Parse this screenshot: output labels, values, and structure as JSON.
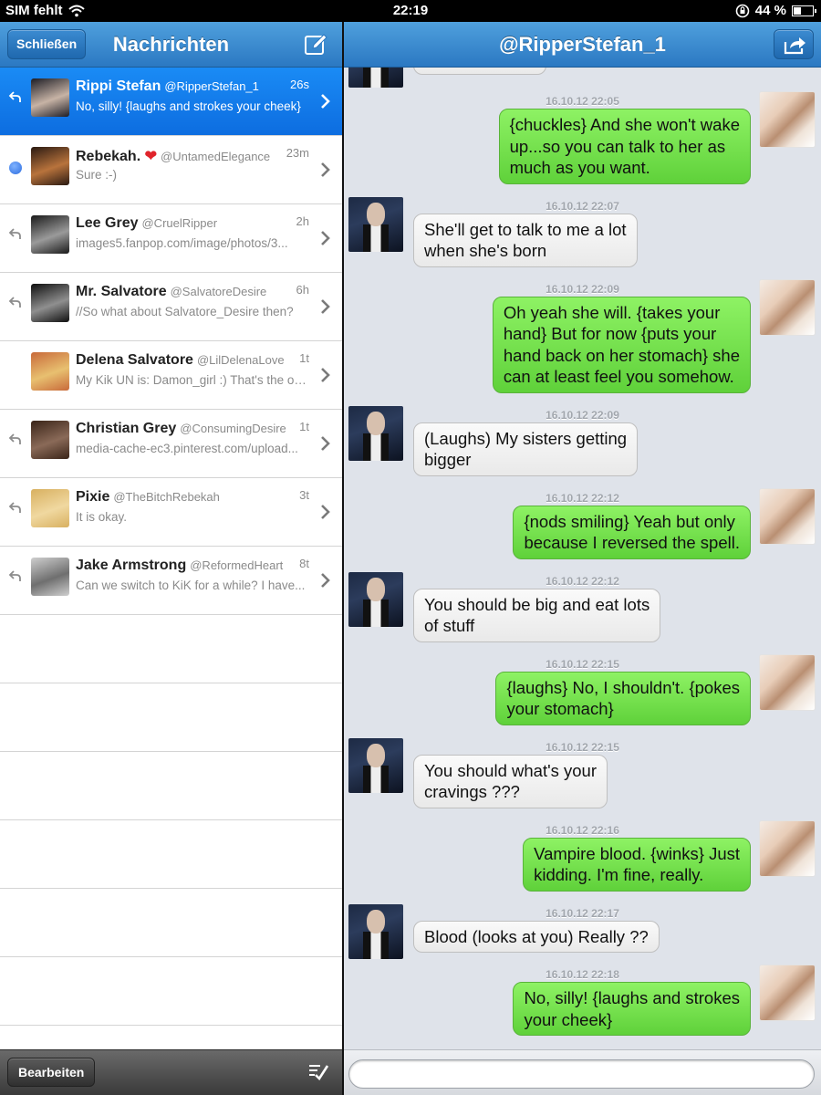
{
  "status": {
    "carrier": "SIM fehlt",
    "time": "22:19",
    "battery": "44 %",
    "battery_level": 0.44
  },
  "left": {
    "close_label": "Schließen",
    "title": "Nachrichten",
    "edit_label": "Bearbeiten",
    "conversations": [
      {
        "name": "Rippi Stefan",
        "handle": "@RipperStefan_1",
        "time": "26s",
        "preview": "No, silly! {laughs and strokes your cheek}",
        "selected": true,
        "unread": false,
        "replied": true,
        "heart": false,
        "avatar_colors": [
          "#1c1c24",
          "#c7b3a5"
        ]
      },
      {
        "name": "Rebekah.",
        "handle": "@UntamedElegance",
        "time": "23m",
        "preview": "Sure :-)",
        "selected": false,
        "unread": true,
        "replied": false,
        "heart": true,
        "avatar_colors": [
          "#2a1a12",
          "#b8733c"
        ]
      },
      {
        "name": "Lee Grey",
        "handle": "@CruelRipper",
        "time": "2h",
        "preview": "images5.fanpop.com/image/photos/3...",
        "selected": false,
        "unread": false,
        "replied": true,
        "heart": false,
        "avatar_colors": [
          "#1a1a1a",
          "#9a9a9a"
        ]
      },
      {
        "name": "Mr. Salvatore",
        "handle": "@SalvatoreDesire",
        "time": "6h",
        "preview": "//So what about Salvatore_Desire then?",
        "selected": false,
        "unread": false,
        "replied": true,
        "heart": false,
        "avatar_colors": [
          "#0f0f0f",
          "#8f8f8f"
        ]
      },
      {
        "name": "Delena Salvatore",
        "handle": "@LilDelenaLove",
        "time": "1t",
        "preview": "My Kik UN is: Damon_girl :) That's the one",
        "selected": false,
        "unread": false,
        "replied": false,
        "heart": false,
        "avatar_colors": [
          "#c86a3a",
          "#e8c070"
        ]
      },
      {
        "name": "Christian Grey",
        "handle": "@ConsumingDesire",
        "time": "1t",
        "preview": "media-cache-ec3.pinterest.com/upload...",
        "selected": false,
        "unread": false,
        "replied": true,
        "heart": false,
        "avatar_colors": [
          "#3a2418",
          "#8a6a58"
        ]
      },
      {
        "name": "Pixie",
        "handle": "@TheBitchRebekah",
        "time": "3t",
        "preview": "It is okay.",
        "selected": false,
        "unread": false,
        "replied": true,
        "heart": false,
        "avatar_colors": [
          "#d8b060",
          "#f0d8a0"
        ]
      },
      {
        "name": "Jake Armstrong",
        "handle": "@ReformedHeart",
        "time": "8t",
        "preview": "Can we switch to KiK for a while? I have...",
        "selected": false,
        "unread": false,
        "replied": true,
        "heart": false,
        "avatar_colors": [
          "#cfcfcf",
          "#6f6f6f"
        ]
      }
    ]
  },
  "right": {
    "title": "@RipperStefan_1",
    "input_value": "",
    "messages": [
      {
        "dir": "out",
        "time": "16.10.12 22:05",
        "lines": [
          "{chuckles} And she won't wake",
          "up...so you can talk to her as",
          "much as you want."
        ]
      },
      {
        "dir": "in",
        "time": "16.10.12 22:07",
        "lines": [
          "She'll get to talk to me a lot",
          "when she's born"
        ]
      },
      {
        "dir": "out",
        "time": "16.10.12 22:09",
        "lines": [
          "Oh yeah she will. {takes your",
          "hand} But for now {puts your",
          "hand back on her stomach} she",
          "can at least feel you somehow."
        ]
      },
      {
        "dir": "in",
        "time": "16.10.12 22:09",
        "lines": [
          "(Laughs) My sisters getting",
          "bigger"
        ]
      },
      {
        "dir": "out",
        "time": "16.10.12 22:12",
        "lines": [
          "{nods smiling} Yeah but only",
          "because I reversed the spell."
        ]
      },
      {
        "dir": "in",
        "time": "16.10.12 22:12",
        "lines": [
          "You should be big and eat lots",
          "of stuff"
        ]
      },
      {
        "dir": "out",
        "time": "16.10.12 22:15",
        "lines": [
          "{laughs} No, I shouldn't. {pokes",
          "your stomach}"
        ]
      },
      {
        "dir": "in",
        "time": "16.10.12 22:15",
        "lines": [
          "You should what's your",
          "cravings ???"
        ]
      },
      {
        "dir": "out",
        "time": "16.10.12 22:16",
        "lines": [
          "Vampire blood. {winks} Just",
          "kidding. I'm fine, really."
        ]
      },
      {
        "dir": "in",
        "time": "16.10.12 22:17",
        "lines": [
          "Blood (looks at you) Really ??"
        ]
      },
      {
        "dir": "out",
        "time": "16.10.12 22:18",
        "lines": [
          "No, silly! {laughs and strokes",
          "your cheek}"
        ]
      }
    ]
  }
}
